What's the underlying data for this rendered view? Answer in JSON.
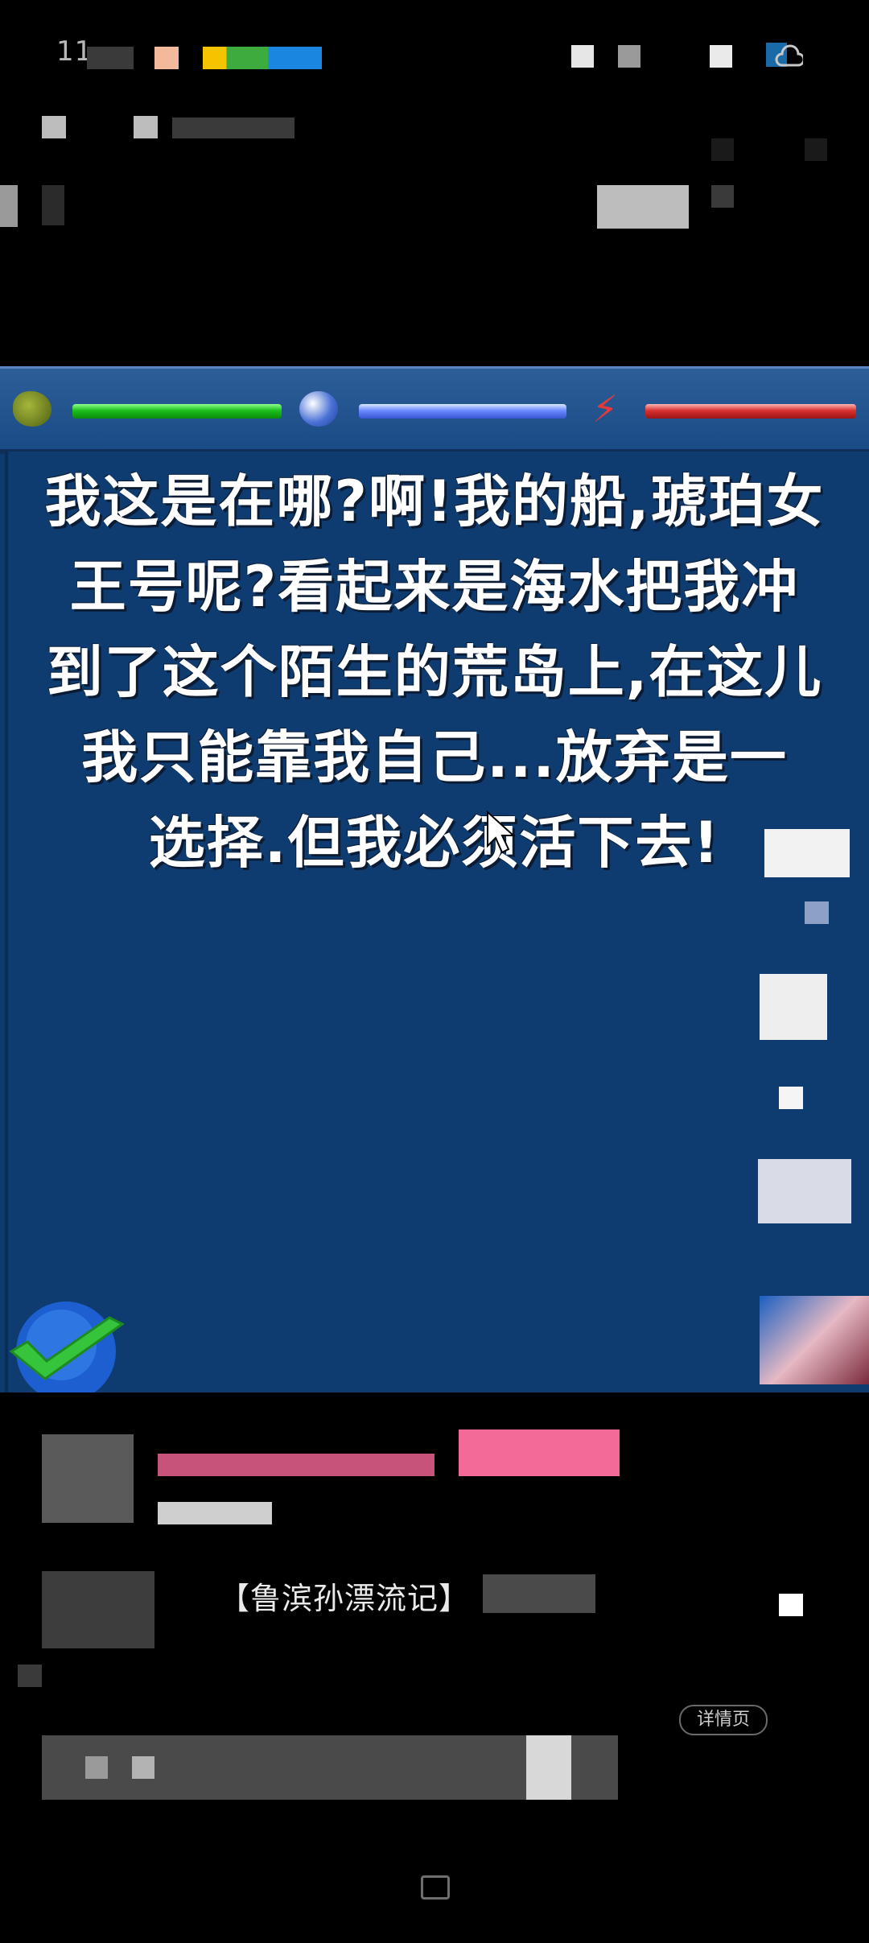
{
  "status_bar": {
    "time": "11"
  },
  "game": {
    "dialog_lines": [
      "我这是在哪?啊!我的船,琥珀女",
      "王号呢?看起来是海水把我冲",
      "到了这个陌生的荒岛上,在这儿",
      "我只能靠我自己...放弃是一",
      "选择.但我必须活下去!"
    ],
    "hud": {
      "health_icon": "turtle-icon",
      "thirst_icon": "water-drop-icon",
      "stamina_icon": "lightning-icon",
      "health_color": "#1bbf1b",
      "thirst_color": "#6b8bff",
      "stamina_color": "#d83131"
    }
  },
  "info": {
    "video_title": "【鲁滨孙漂流记】",
    "detail_button_label": "详情页"
  },
  "colors": {
    "game_background": "#0f3c70",
    "hud_background": "#2d5e98",
    "page_background": "#000000"
  }
}
